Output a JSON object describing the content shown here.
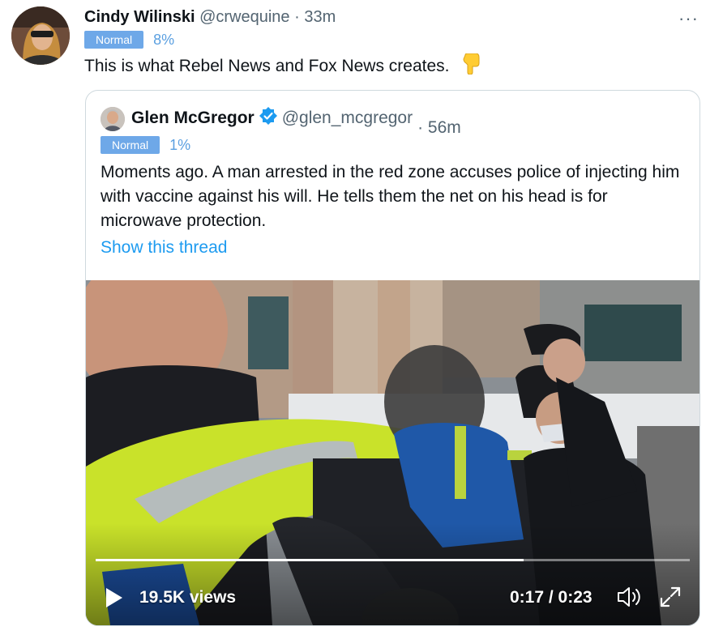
{
  "tweet": {
    "author_name": "Cindy Wilinski",
    "handle": "@crwequine",
    "separator": "·",
    "time": "33m",
    "badge": "Normal",
    "percent": "8%",
    "text": "This is what Rebel News and Fox News creates.",
    "emoji": "pointing-down-hand-icon",
    "more_label": "···"
  },
  "quoted": {
    "author_name": "Glen McGregor",
    "handle": "@glen_mcgregor",
    "time": "· 56m",
    "badge": "Normal",
    "percent": "1%",
    "text": "Moments ago. A man arrested in the red zone accuses police of injecting him with vaccine against his will. He tells them the net on his head is for microwave protection.",
    "show_thread": "Show this thread",
    "video": {
      "views": "19.5K views",
      "timecode": "0:17 / 0:23",
      "progress": 0.72
    }
  },
  "colors": {
    "accent": "#1d9bf0",
    "badge": "#6ea8e8",
    "secondary_text": "#536471",
    "border": "#cfd9de"
  }
}
